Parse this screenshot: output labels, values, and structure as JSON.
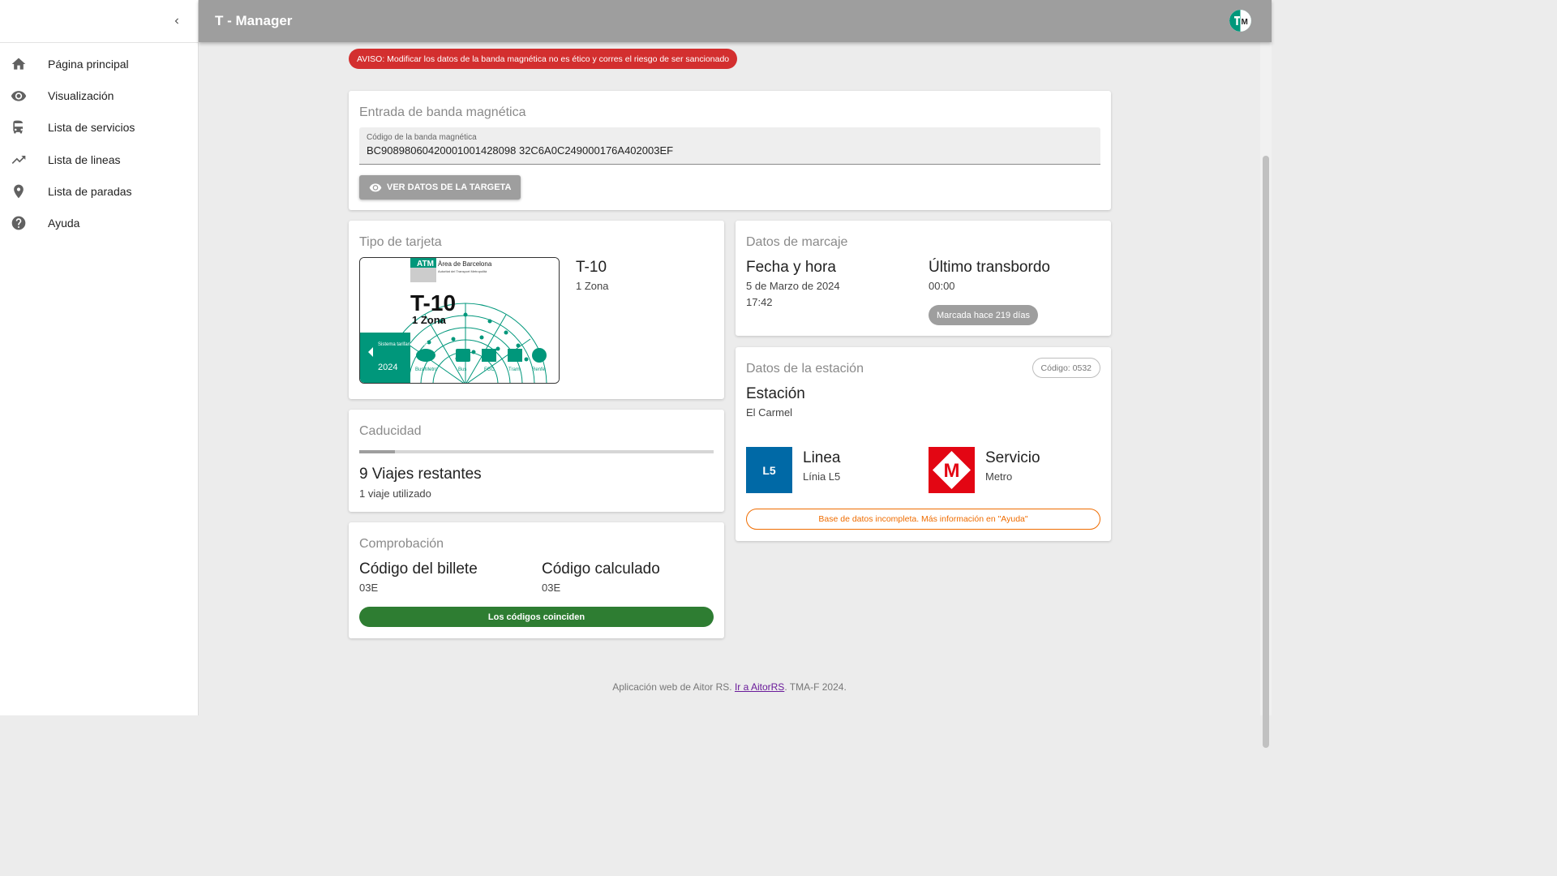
{
  "app": {
    "title": "T - Manager"
  },
  "sidebar": {
    "items": [
      {
        "label": "Página principal",
        "icon": "home-icon"
      },
      {
        "label": "Visualización",
        "icon": "eye-icon"
      },
      {
        "label": "Lista de servicios",
        "icon": "bus-icon"
      },
      {
        "label": "Lista de lineas",
        "icon": "trend-icon"
      },
      {
        "label": "Lista de paradas",
        "icon": "pin-icon"
      },
      {
        "label": "Ayuda",
        "icon": "help-icon"
      }
    ]
  },
  "alert": {
    "text": "AVISO: Modificar los datos de la banda magnética no es ético y corres el riesgo de ser sancionado"
  },
  "magnetic": {
    "title": "Entrada de banda magnética",
    "field_label": "Código de la banda magnética",
    "value": "BC90898060420001001428098 32C6A0C249000176A402003EF",
    "button": "VER DATOS DE LA TARGETA"
  },
  "ticket_type": {
    "title": "Tipo de tarjeta",
    "name": "T-10",
    "zones": "1 Zona",
    "image": {
      "brand": "ATM",
      "area": "Àrea de Barcelona",
      "authority": "Autoritat del Transport Metropolità",
      "big": "T-10",
      "zona": "1 Zona",
      "system": "Sistema tarifari integrat",
      "year": "2024",
      "modes": [
        "Bus/Metro",
        "Bus",
        "FGC",
        "Tram",
        "Renfe"
      ]
    }
  },
  "expiry": {
    "title": "Caducidad",
    "progress": 0.1,
    "remaining": "9 Viajes restantes",
    "used": "1 viaje utilizado"
  },
  "check": {
    "title": "Comprobación",
    "ticket_code_label": "Código del billete",
    "ticket_code": "03E",
    "calc_code_label": "Código calculado",
    "calc_code": "03E",
    "result": "Los códigos coinciden"
  },
  "marking": {
    "title": "Datos de marcaje",
    "datetime_label": "Fecha y hora",
    "date": "5 de Marzo de 2024",
    "time": "17:42",
    "transfer_label": "Último transbordo",
    "transfer": "00:00",
    "ago": "Marcada hace 219 días"
  },
  "station": {
    "title": "Datos de la estación",
    "code": "Código: 0532",
    "station_label": "Estación",
    "station": "El Carmel",
    "line_badge": "L5",
    "line_label": "Linea",
    "line": "Línia L5",
    "service_label": "Servicio",
    "service": "Metro",
    "service_logo": "M",
    "note": "Base de datos incompleta. Más información en \"Ayuda\""
  },
  "footer": {
    "prefix": "Aplicación web de Aitor RS. ",
    "link": "Ir a AitorRS",
    "suffix": ". TMA-F 2024."
  },
  "colors": {
    "topbar": "#9e9e9e",
    "alert": "#d32f2f",
    "success": "#2e7d32",
    "warning": "#ef6c00",
    "line_l5": "#0069a6",
    "metro": "#e30613",
    "atm_green": "#00977b"
  }
}
